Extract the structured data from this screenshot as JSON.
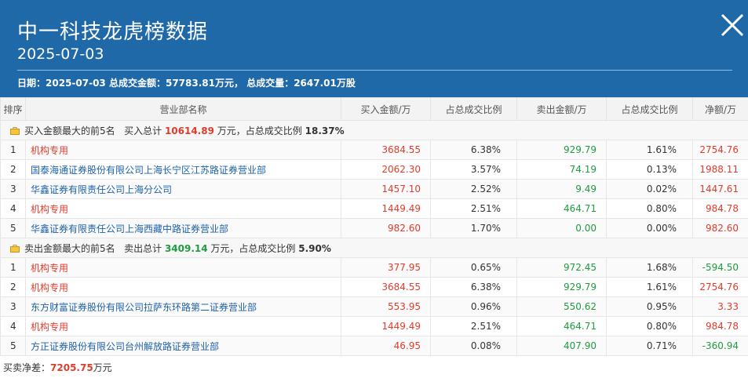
{
  "header": {
    "title": "中一科技龙虎榜数据",
    "date": "2025-07-03",
    "summary_date_label": "日期：",
    "summary_date": "2025-07-03",
    "summary_amount_label": "总成交金额：",
    "summary_amount": "57783.81万元，",
    "summary_volume_label": "总成交量：",
    "summary_volume": "2647.01万股"
  },
  "columns": [
    "排序",
    "营业部名称",
    "买入金额/万",
    "占总成交比例",
    "卖出金额/万",
    "占总成交比例",
    "净额/万"
  ],
  "buy_section": {
    "prefix": "买入金额最大的前5名",
    "total_label": "买入总计",
    "total": "10614.89",
    "unit_ratio_label": "万元，占总成交比例",
    "ratio": "18.37%",
    "rows": [
      {
        "idx": "1",
        "name": "机构专用",
        "buy": "3684.55",
        "buy_ratio": "6.38%",
        "sell": "929.79",
        "sell_ratio": "1.61%",
        "net": "2754.76"
      },
      {
        "idx": "2",
        "name": "国泰海通证券股份有限公司上海长宁区江苏路证券营业部",
        "buy": "2062.30",
        "buy_ratio": "3.57%",
        "sell": "74.19",
        "sell_ratio": "0.13%",
        "net": "1988.11"
      },
      {
        "idx": "3",
        "name": "华鑫证券有限责任公司上海分公司",
        "buy": "1457.10",
        "buy_ratio": "2.52%",
        "sell": "9.49",
        "sell_ratio": "0.02%",
        "net": "1447.61"
      },
      {
        "idx": "4",
        "name": "机构专用",
        "buy": "1449.49",
        "buy_ratio": "2.51%",
        "sell": "464.71",
        "sell_ratio": "0.80%",
        "net": "984.78"
      },
      {
        "idx": "5",
        "name": "华鑫证券有限责任公司上海西藏中路证券营业部",
        "buy": "982.60",
        "buy_ratio": "1.70%",
        "sell": "0.00",
        "sell_ratio": "0.00%",
        "net": "982.60"
      }
    ]
  },
  "sell_section": {
    "prefix": "卖出金额最大的前5名",
    "total_label": "卖出总计",
    "total": "3409.14",
    "unit_ratio_label": "万元，占总成交比例",
    "ratio": "5.90%",
    "rows": [
      {
        "idx": "1",
        "name": "机构专用",
        "buy": "377.95",
        "buy_ratio": "0.65%",
        "sell": "972.45",
        "sell_ratio": "1.68%",
        "net": "-594.50"
      },
      {
        "idx": "2",
        "name": "机构专用",
        "buy": "3684.55",
        "buy_ratio": "6.38%",
        "sell": "929.79",
        "sell_ratio": "1.61%",
        "net": "2754.76"
      },
      {
        "idx": "3",
        "name": "东方财富证券股份有限公司拉萨东环路第二证券营业部",
        "buy": "553.95",
        "buy_ratio": "0.96%",
        "sell": "550.62",
        "sell_ratio": "0.95%",
        "net": "3.33"
      },
      {
        "idx": "4",
        "name": "机构专用",
        "buy": "1449.49",
        "buy_ratio": "2.51%",
        "sell": "464.71",
        "sell_ratio": "0.80%",
        "net": "984.78"
      },
      {
        "idx": "5",
        "name": "方正证券股份有限公司台州解放路证券营业部",
        "buy": "46.95",
        "buy_ratio": "0.08%",
        "sell": "407.90",
        "sell_ratio": "0.71%",
        "net": "-360.94"
      }
    ]
  },
  "footer": {
    "label": "买卖净差：",
    "value": "7205.75",
    "unit": "万元"
  },
  "icons": {
    "close": "close-icon",
    "section": "briefcase-icon"
  },
  "colors": {
    "header_bg": "#2069a8",
    "buy": "#e03c2c",
    "sell": "#1f9c3f",
    "link": "#1e62a8"
  }
}
